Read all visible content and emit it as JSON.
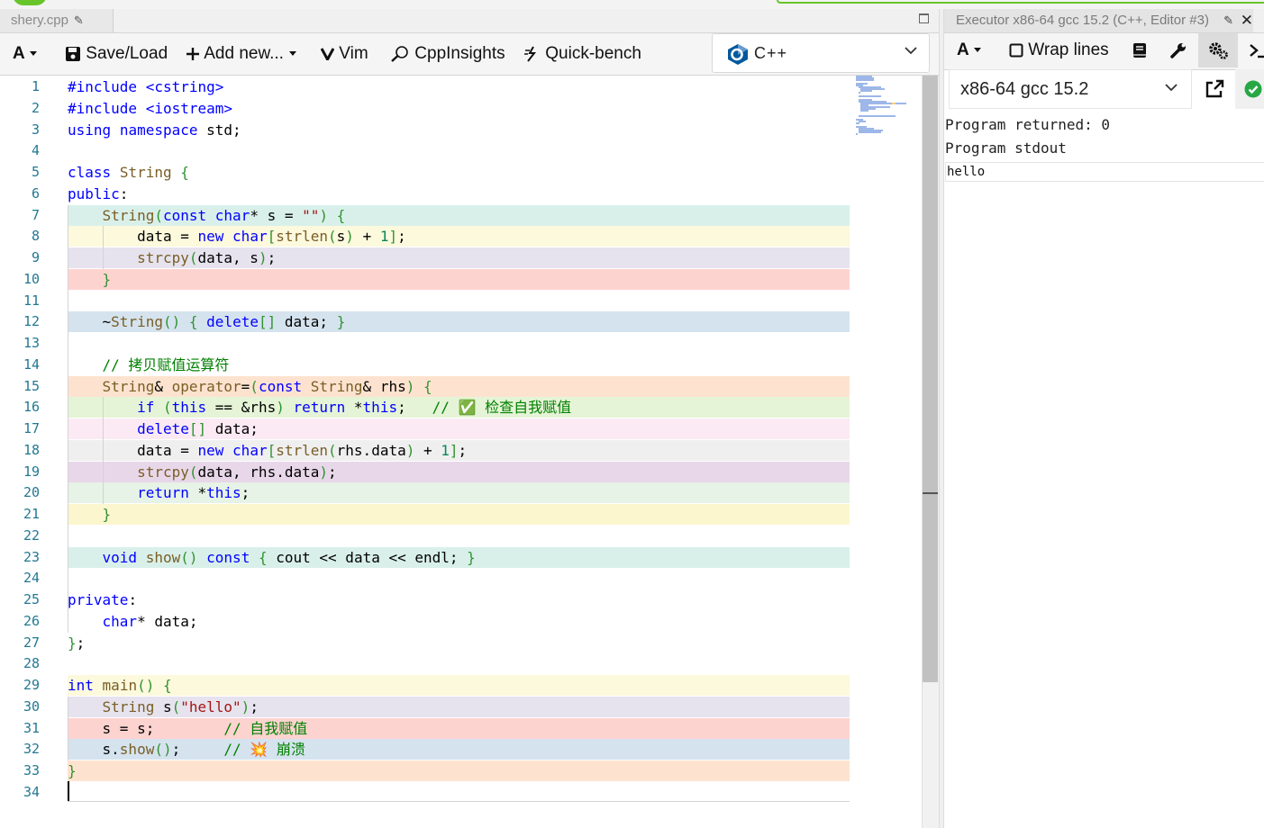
{
  "editor": {
    "tab_title": "shery.cpp",
    "toolbar": {
      "font_label": "A",
      "save_load": "Save/Load",
      "add_new": "Add new...",
      "vim": "Vim",
      "cppinsights": "CppInsights",
      "quickbench": "Quick-bench"
    },
    "language": "C++",
    "code_lines": [
      "#include <cstring>",
      "#include <iostream>",
      "using namespace std;",
      "",
      "class String {",
      "public:",
      "    String(const char* s = \"\") {",
      "        data = new char[strlen(s) + 1];",
      "        strcpy(data, s);",
      "    }",
      "",
      "    ~String() { delete[] data; }",
      "",
      "    // 拷贝赋值运算符",
      "    String& operator=(const String& rhs) {",
      "        if (this == &rhs) return *this;   // ✅ 检查自我赋值",
      "        delete[] data;",
      "        data = new char[strlen(rhs.data) + 1];",
      "        strcpy(data, rhs.data);",
      "        return *this;",
      "    }",
      "",
      "    void show() const { cout << data << endl; }",
      "",
      "private:",
      "    char* data;",
      "};",
      "",
      "int main() {",
      "    String s(\"hello\");",
      "    s = s;        // 自我赋值",
      "    s.show();     // 💥 崩溃",
      "}",
      ""
    ],
    "line_numbers": [
      "1",
      "2",
      "3",
      "4",
      "5",
      "6",
      "7",
      "8",
      "9",
      "10",
      "11",
      "12",
      "13",
      "14",
      "15",
      "16",
      "17",
      "18",
      "19",
      "20",
      "21",
      "22",
      "23",
      "24",
      "25",
      "26",
      "27",
      "28",
      "29",
      "30",
      "31",
      "32",
      "33",
      "34"
    ],
    "highlight_colors": {
      "7": "#d9f0ea",
      "8": "#fcf9dd",
      "9": "#e6e3ee",
      "10": "#fdd3d0",
      "12": "#d5e3ee",
      "15": "#fde3cf",
      "16": "#e5f4d6",
      "17": "#fbeaf3",
      "18": "#efefef",
      "19": "#e8d7e9",
      "20": "#e6f3e6",
      "21": "#fcf6cf",
      "23": "#d9f0ea",
      "29": "#fcf9dd",
      "30": "#e6e3ee",
      "31": "#fdd3d0",
      "32": "#d5e3ee",
      "33": "#fde3cf"
    }
  },
  "executor": {
    "tab_title": "Executor x86-64 gcc 15.2 (C++, Editor #3)",
    "font_label": "A",
    "wrap_lines": "Wrap lines",
    "compiler": "x86-64 gcc 15.2",
    "program_returned": "Program returned: 0",
    "stdout_label": "Program stdout",
    "stdout": "hello"
  }
}
